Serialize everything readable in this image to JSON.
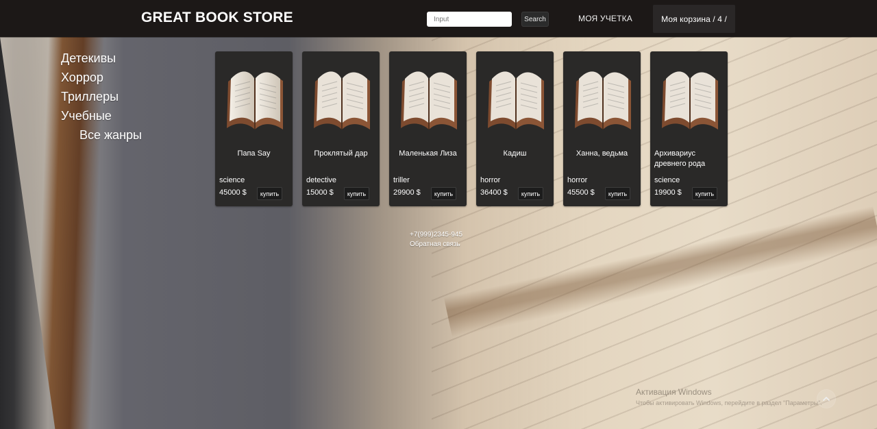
{
  "header": {
    "logo": "GREAT BOOK STORE",
    "search": {
      "placeholder": "Input",
      "button_label": "Search"
    },
    "account_label": "МОЯ УЧЕТКА",
    "cart_label": "Моя корзина / 4 /"
  },
  "sidebar": {
    "genres": [
      {
        "label": "Детекивы"
      },
      {
        "label": "Хоррор"
      },
      {
        "label": "Триллеры"
      },
      {
        "label": "Учебные"
      },
      {
        "label": "Все жанры"
      }
    ]
  },
  "products": [
    {
      "title": "Папа Say",
      "genre": "science",
      "price": "45000 $",
      "buy_label": "купить"
    },
    {
      "title": "Проклятый дар",
      "genre": "detective",
      "price": "15000 $",
      "buy_label": "купить"
    },
    {
      "title": "Маленькая Лиза",
      "genre": "triller",
      "price": "29900 $",
      "buy_label": "купить"
    },
    {
      "title": "Кадиш",
      "genre": "horror",
      "price": "36400 $",
      "buy_label": "купить"
    },
    {
      "title": "Ханна, ведьма",
      "genre": "horror",
      "price": "45500 $",
      "buy_label": "купить"
    },
    {
      "title": "Архивариус древнего рода",
      "genre": "science",
      "price": "19900 $",
      "buy_label": "купить"
    }
  ],
  "footer": {
    "phone": "+7(999)2345-945",
    "feedback_label": "Обратная связь"
  },
  "watermark": {
    "line1": "Активация Windows",
    "line2": "Чтобы активировать Windows, перейдите в раздел \"Параметры\"."
  },
  "colors": {
    "header_bg": "#1c1817",
    "card_bg": "#2a2928",
    "text": "#ffffff"
  },
  "icons": {
    "book": "book-image-icon",
    "scroll_top": "scroll-top-icon"
  }
}
